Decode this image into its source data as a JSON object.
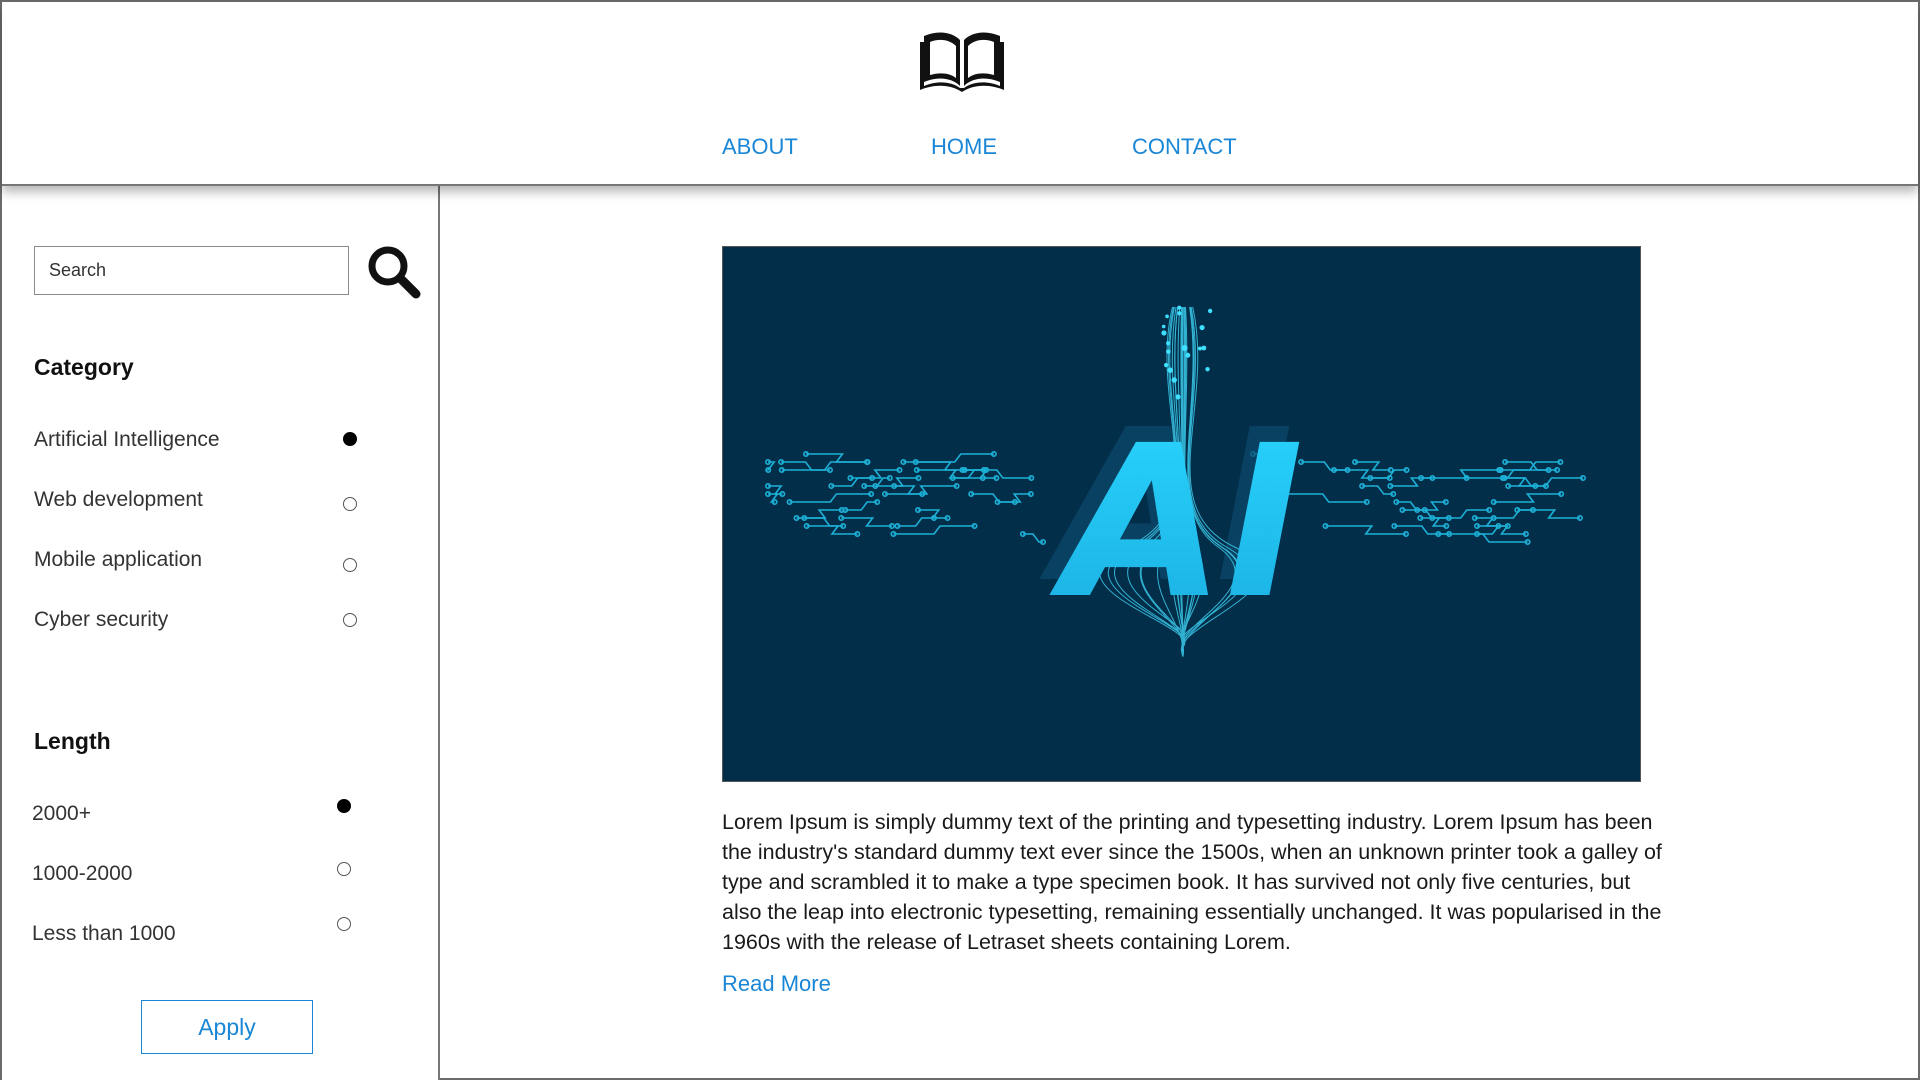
{
  "header": {
    "logo_icon": "open-book-icon",
    "nav": [
      {
        "label": "ABOUT"
      },
      {
        "label": "HOME"
      },
      {
        "label": "CONTACT"
      }
    ]
  },
  "sidebar": {
    "search": {
      "placeholder": "Search",
      "value": "",
      "icon": "search-icon"
    },
    "category": {
      "title": "Category",
      "options": [
        {
          "label": "Artificial Intelligence",
          "selected": true
        },
        {
          "label": "Web development",
          "selected": false
        },
        {
          "label": "Mobile application",
          "selected": false
        },
        {
          "label": "Cyber security",
          "selected": false
        }
      ]
    },
    "length": {
      "title": "Length",
      "options": [
        {
          "label": "2000+",
          "selected": true
        },
        {
          "label": "1000-2000",
          "selected": false
        },
        {
          "label": "Less than 1000",
          "selected": false
        }
      ]
    },
    "apply_label": "Apply"
  },
  "main": {
    "hero": {
      "text": "AI",
      "background": "#032e4a",
      "accent": "#1fc8f0"
    },
    "article_text": "Lorem Ipsum is simply dummy text of the printing and typesetting industry. Lorem Ipsum has been the industry's standard dummy text ever since the 1500s, when an unknown printer took a galley of type and scrambled it to make a type specimen book. It has survived not only five centuries, but also the leap into electronic typesetting, remaining essentially unchanged. It was popularised in the 1960s with the release of Letraset sheets containing Lorem.",
    "read_more": "Read More"
  },
  "colors": {
    "link": "#1a86d6",
    "border": "#777777"
  }
}
